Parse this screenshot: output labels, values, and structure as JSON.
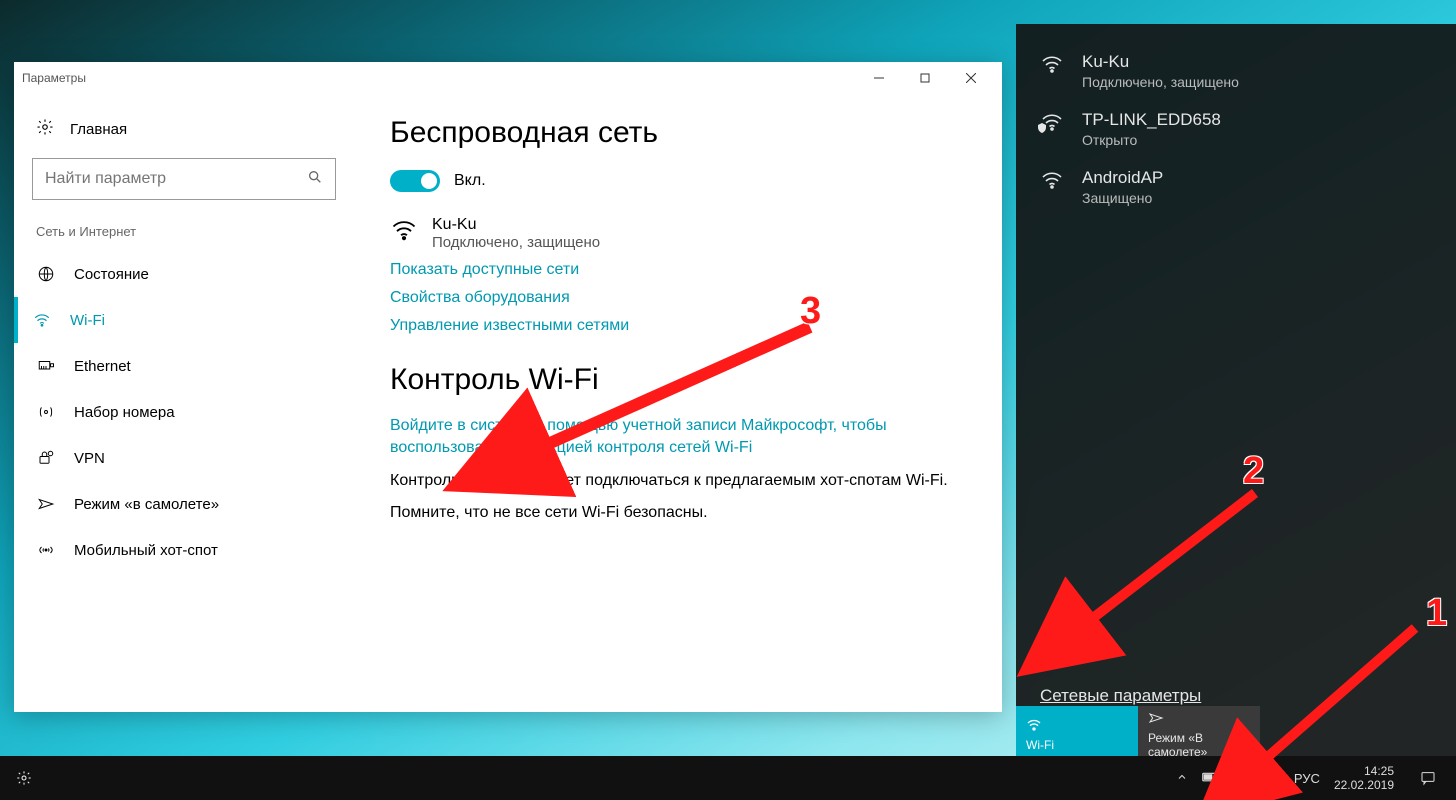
{
  "window": {
    "title": "Параметры",
    "home": "Главная",
    "search_placeholder": "Найти параметр",
    "section": "Сеть и Интернет",
    "nav": [
      {
        "label": "Состояние"
      },
      {
        "label": "Wi-Fi"
      },
      {
        "label": "Ethernet"
      },
      {
        "label": "Набор номера"
      },
      {
        "label": "VPN"
      },
      {
        "label": "Режим «в самолете»"
      },
      {
        "label": "Мобильный хот-спот"
      }
    ]
  },
  "main": {
    "h1": "Беспроводная сеть",
    "toggle_label": "Вкл.",
    "wifi_name": "Ku-Ku",
    "wifi_status": "Подключено, защищено",
    "link_show": "Показать доступные сети",
    "link_hw": "Свойства оборудования",
    "link_known": "Управление известными сетями",
    "h2": "Контроль Wi-Fi",
    "link_signin": "Войдите в систему с помощью учетной записи Майкрософт, чтобы воспользоваться функцией контроля сетей Wi-Fi",
    "p1": "Контроль Wi-Fi позволяет подключаться к предлагаемым хот-спотам Wi-Fi.",
    "p2": "Помните, что не все сети Wi-Fi безопасны."
  },
  "flyout": {
    "nets": [
      {
        "name": "Ku-Ku",
        "sub": "Подключено, защищено"
      },
      {
        "name": "TP-LINK_EDD658",
        "sub": "Открыто"
      },
      {
        "name": "AndroidAP",
        "sub": "Защищено"
      }
    ],
    "settings_link": "Сетевые параметры",
    "tile_wifi": "Wi-Fi",
    "tile_plane_l1": "Режим «В",
    "tile_plane_l2": "самолете»"
  },
  "taskbar": {
    "lang": "РУС",
    "time": "14:25",
    "date": "22.02.2019"
  },
  "annot": {
    "n1": "1",
    "n2": "2",
    "n3": "3"
  }
}
